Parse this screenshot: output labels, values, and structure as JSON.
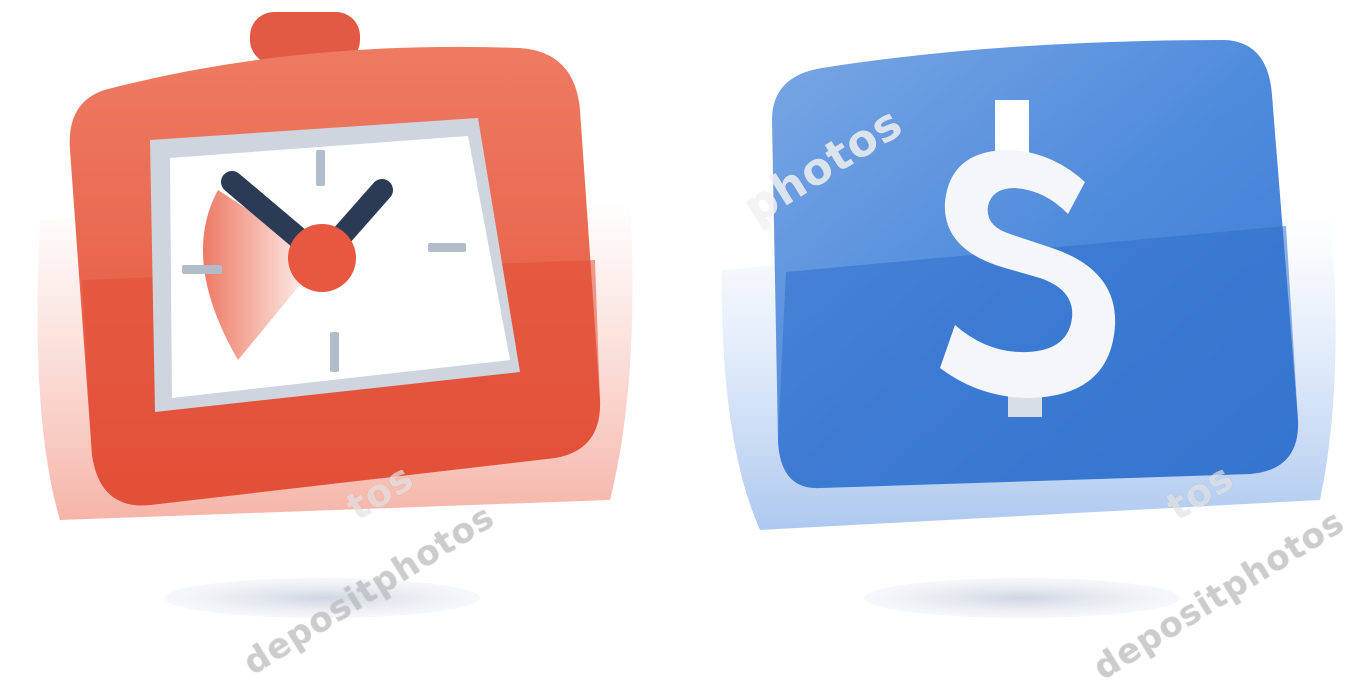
{
  "illustration": {
    "left_icon": "alarm-clock-icon",
    "right_icon": "dollar-sign-icon",
    "dollar_symbol": "$"
  },
  "watermark": {
    "top": "photos",
    "left": "tos",
    "right": "tos",
    "bottom_left": "depositphotos",
    "bottom_right": "depositphotos"
  },
  "colors": {
    "clock_red": "#e8573f",
    "clock_red_light": "#f08a76",
    "money_blue": "#3d7fd6",
    "money_blue_light": "#6aa0e4",
    "hand_navy": "#2b3a55",
    "shadow_gray": "#dfe3ea"
  }
}
